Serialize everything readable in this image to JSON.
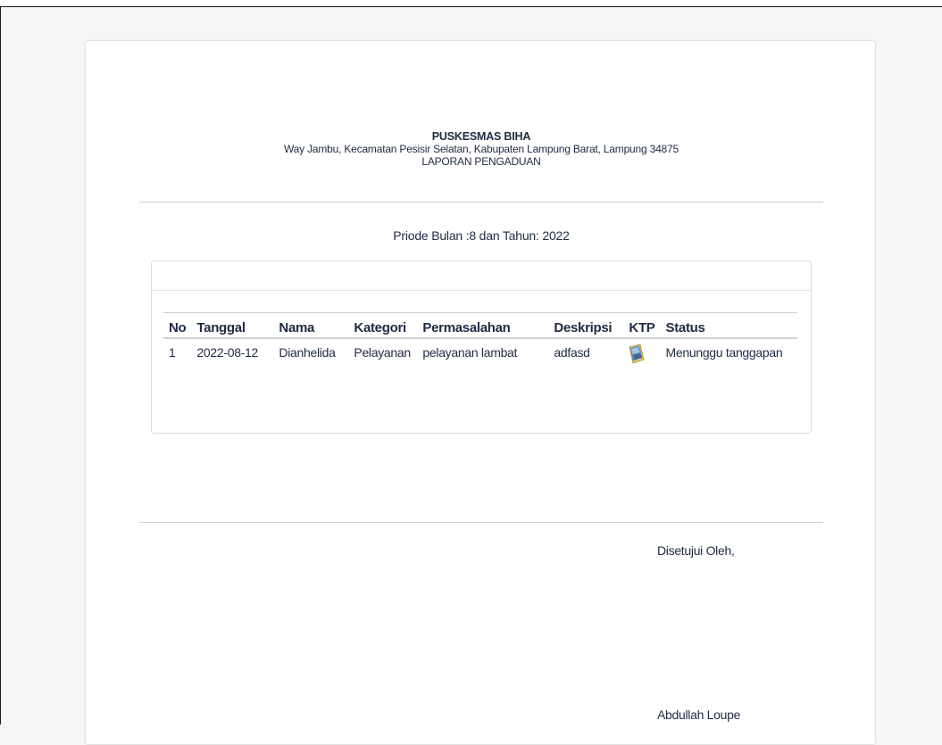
{
  "header": {
    "org_name": "PUSKESMAS BIHA",
    "address": "Way Jambu, Kecamatan Pesisir Selatan, Kabupaten Lampung Barat, Lampung 34875",
    "report_title": "LAPORAN PENGADUAN"
  },
  "period": "Priode Bulan :8 dan Tahun: 2022",
  "table": {
    "columns": [
      "No",
      "Tanggal",
      "Nama",
      "Kategori",
      "Permasalahan",
      "Deskripsi",
      "KTP",
      "Status"
    ],
    "rows": [
      {
        "no": "1",
        "tanggal": "2022-08-12",
        "nama": "Dianhelida",
        "kategori": "Pelayanan",
        "permasalahan": "pelayanan lambat",
        "deskripsi": "adfasd",
        "ktp_icon": "id-card-image-icon",
        "status": "Menunggu tanggapan"
      }
    ]
  },
  "signature": {
    "approved_by": "Disetujui Oleh,",
    "name": "Abdullah Loupe"
  }
}
